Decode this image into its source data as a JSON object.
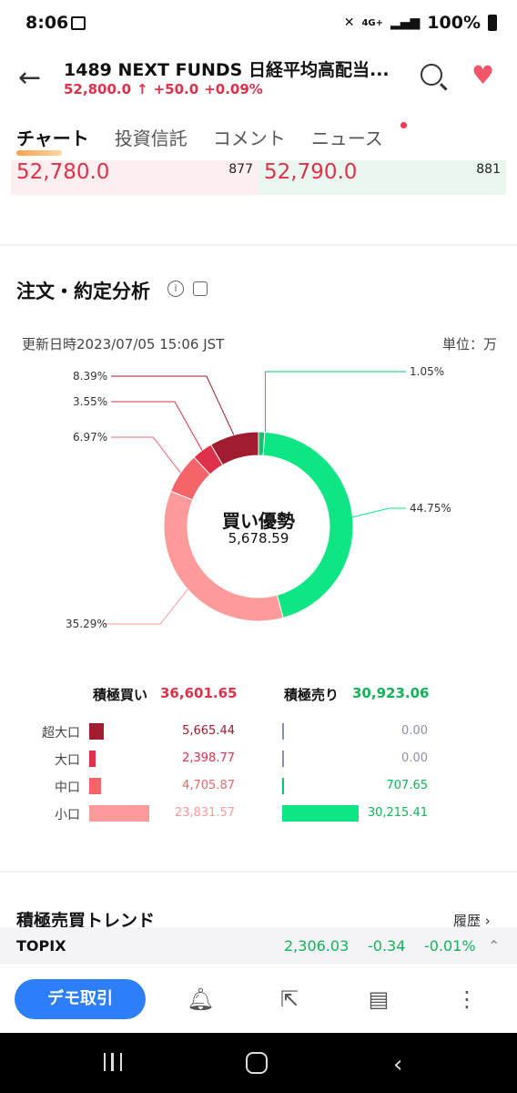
{
  "status": {
    "time": "8:06",
    "battery": "100%",
    "net": "4G+"
  },
  "header": {
    "title": "1489  NEXT FUNDS 日経平均高配当...",
    "price": "52,800.0",
    "change": "+50.0",
    "change_pct": "+0.09%"
  },
  "tabs": [
    "チャート",
    "投資信託",
    "コメント",
    "ニュース"
  ],
  "orderbook": {
    "bid_price": "52,780.0",
    "bid_qty": "877",
    "ask_price": "52,790.0",
    "ask_qty": "881"
  },
  "analysis": {
    "title": "注文・約定分析",
    "updated": "更新日時2023/07/05 15:06 JST",
    "unit": "単位：万",
    "center_label": "買い優勢",
    "center_value": "5,678.59"
  },
  "chart_data": {
    "type": "pie",
    "labels": [
      "積極買い 超大口",
      "積極買い 大口",
      "積極買い 中口",
      "積極買い 小口",
      "積極売り 中口",
      "積極売り 小口"
    ],
    "values": [
      8.39,
      3.55,
      6.97,
      35.29,
      1.05,
      44.75
    ],
    "value_labels": [
      "8.39%",
      "3.55%",
      "6.97%",
      "35.29%",
      "1.05%",
      "44.75%"
    ],
    "colors": [
      "#a11c2e",
      "#e0314b",
      "#f46468",
      "#ff9a9a",
      "#13c36f",
      "#0ee583"
    ]
  },
  "summary": {
    "buy_label": "積極買い",
    "buy_total": "36,601.65",
    "sell_label": "積極売り",
    "sell_total": "30,923.06",
    "rows": [
      {
        "label": "超大口",
        "buy": "5,665.44",
        "sell": "0.00"
      },
      {
        "label": "大口",
        "buy": "2,398.77",
        "sell": "0.00"
      },
      {
        "label": "中口",
        "buy": "4,705.87",
        "sell": "707.65"
      },
      {
        "label": "小口",
        "buy": "23,831.57",
        "sell": "30,215.41"
      }
    ]
  },
  "trend": {
    "title": "積極売買トレンド",
    "history": "履歴"
  },
  "ticker": {
    "name": "TOPIX",
    "value": "2,306.03",
    "change": "-0.34",
    "pct": "-0.01%"
  },
  "actions": {
    "demo": "デモ取引"
  },
  "colors": {
    "accent": "#2d7ff9",
    "up": "#e0314b",
    "down": "#12b35a"
  }
}
